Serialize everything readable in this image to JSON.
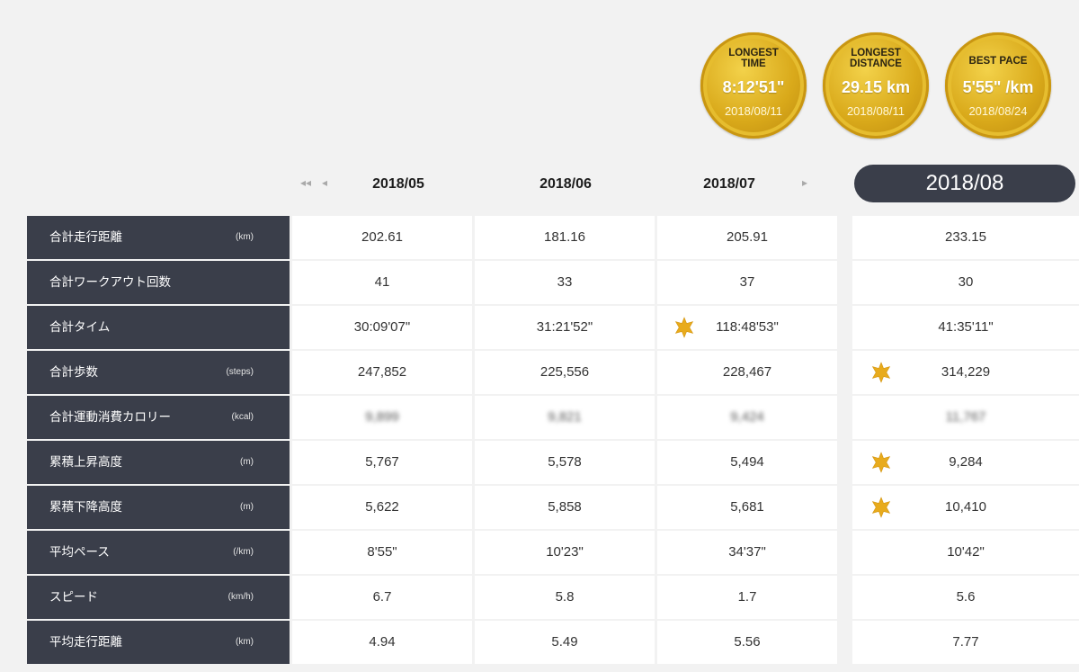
{
  "medals": [
    {
      "title": "LONGEST\nTIME",
      "value": "8:12'51\"",
      "date": "2018/08/11"
    },
    {
      "title": "LONGEST\nDISTANCE",
      "value": "29.15 km",
      "date": "2018/08/11"
    },
    {
      "title": "BEST PACE",
      "value": "5'55\" /km",
      "date": "2018/08/24"
    }
  ],
  "nav": {
    "first_icon": "◂◂",
    "prev_icon": "◂",
    "next_icon": "▸"
  },
  "months": [
    "2018/05",
    "2018/06",
    "2018/07"
  ],
  "current_month": "2018/08",
  "colors": {
    "label_bg": "#3a3e4a",
    "medal_gold": "#d9a91a",
    "star": "#e8ab1c"
  },
  "rows": [
    {
      "label": "合計走行距離",
      "unit": "(km)",
      "values": [
        "202.61",
        "181.16",
        "205.91",
        "233.15"
      ],
      "stars": [
        false,
        false,
        false,
        false
      ]
    },
    {
      "label": "合計ワークアウト回数",
      "unit": "",
      "values": [
        "41",
        "33",
        "37",
        "30"
      ],
      "stars": [
        false,
        false,
        false,
        false
      ]
    },
    {
      "label": "合計タイム",
      "unit": "",
      "values": [
        "30:09'07\"",
        "31:21'52\"",
        "118:48'53\"",
        "41:35'11\""
      ],
      "stars": [
        false,
        false,
        true,
        false
      ]
    },
    {
      "label": "合計歩数",
      "unit": "(steps)",
      "values": [
        "247,852",
        "225,556",
        "228,467",
        "314,229"
      ],
      "stars": [
        false,
        false,
        false,
        true
      ]
    },
    {
      "label": "合計運動消費カロリー",
      "unit": "(kcal)",
      "values": [
        "9,899",
        "9,821",
        "9,424",
        "11,767"
      ],
      "stars": [
        false,
        false,
        false,
        false
      ],
      "blurred": true
    },
    {
      "label": "累積上昇高度",
      "unit": "(m)",
      "values": [
        "5,767",
        "5,578",
        "5,494",
        "9,284"
      ],
      "stars": [
        false,
        false,
        false,
        true
      ]
    },
    {
      "label": "累積下降高度",
      "unit": "(m)",
      "values": [
        "5,622",
        "5,858",
        "5,681",
        "10,410"
      ],
      "stars": [
        false,
        false,
        false,
        true
      ]
    },
    {
      "label": "平均ペース",
      "unit": "(/km)",
      "values": [
        "8'55\"",
        "10'23\"",
        "34'37\"",
        "10'42\""
      ],
      "stars": [
        false,
        false,
        false,
        false
      ]
    },
    {
      "label": "スピード",
      "unit": "(km/h)",
      "values": [
        "6.7",
        "5.8",
        "1.7",
        "5.6"
      ],
      "stars": [
        false,
        false,
        false,
        false
      ]
    },
    {
      "label": "平均走行距離",
      "unit": "(km)",
      "values": [
        "4.94",
        "5.49",
        "5.56",
        "7.77"
      ],
      "stars": [
        false,
        false,
        false,
        false
      ]
    }
  ]
}
